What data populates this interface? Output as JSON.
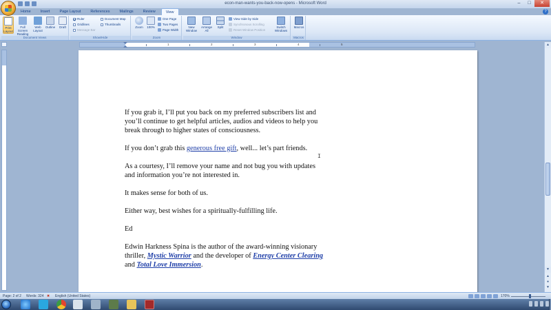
{
  "window": {
    "title": "econ-man-wants-you-back-now-opens - Microsoft Word",
    "minimize": "–",
    "maximize": "□",
    "close": "✕"
  },
  "ribbon": {
    "tabs": [
      "Home",
      "Insert",
      "Page Layout",
      "References",
      "Mailings",
      "Review",
      "View"
    ],
    "active_tab": "View",
    "groups": {
      "document_views": {
        "label": "Document Views",
        "print_layout": "Print Layout",
        "full_screen_reading": "Full Screen Reading",
        "web_layout": "Web Layout",
        "outline": "Outline",
        "draft": "Draft"
      },
      "show_hide": {
        "label": "Show/Hide",
        "ruler": "Ruler",
        "gridlines": "Gridlines",
        "message_bar": "Message Bar",
        "document_map": "Document Map",
        "thumbnails": "Thumbnails"
      },
      "zoom": {
        "label": "Zoom",
        "zoom": "Zoom",
        "hundred": "100%",
        "one_page": "One Page",
        "two_pages": "Two Pages",
        "page_width": "Page Width"
      },
      "window": {
        "label": "Window",
        "new_window": "New Window",
        "arrange_all": "Arrange All",
        "split": "Split",
        "view_side_by_side": "View Side by Side",
        "synchronous_scrolling": "Synchronous Scrolling",
        "reset_window_position": "Reset Window Position",
        "switch_windows": "Switch Windows"
      },
      "macros": {
        "label": "Macros",
        "macros": "Macros"
      }
    }
  },
  "ruler": {
    "numbers": [
      "1",
      "2",
      "3",
      "4",
      "5"
    ]
  },
  "document": {
    "paragraphs": {
      "p1": "If you grab it, I’ll put you back on my preferred subscribers list and you’ll continue to get helpful articles, audios and videos to help you break through to higher states of consciousness.",
      "p2_before": "If you don’t grab this ",
      "p2_link": "generous free gift",
      "p2_after": ", well... let’s part friends.",
      "p3": "As a courtesy, I’ll remove your name and not bug you with updates and information you’re not interested in.",
      "p4": "It makes sense for both of us.",
      "p5": "Either way, best wishes for a spiritually-fulfilling life.",
      "p6": "Ed",
      "p7_a": "Edwin Harkness Spina is the author of the award-winning visionary thriller, ",
      "p7_link1": "Mystic Warrior",
      "p7_b": " and the developer of ",
      "p7_link2": "Energy Center Clearing",
      "p7_c": " and ",
      "p7_link3": "Total Love Immersion",
      "p7_d": "."
    }
  },
  "statusbar": {
    "page": "Page: 2 of 2",
    "words": "Words: 324",
    "language": "English (United States)",
    "zoom": "170%"
  },
  "colors": {
    "accent": "#15428b",
    "link": "#1f3fa8",
    "page_bg": "#ffffff",
    "workspace": "#9fb5d2"
  }
}
